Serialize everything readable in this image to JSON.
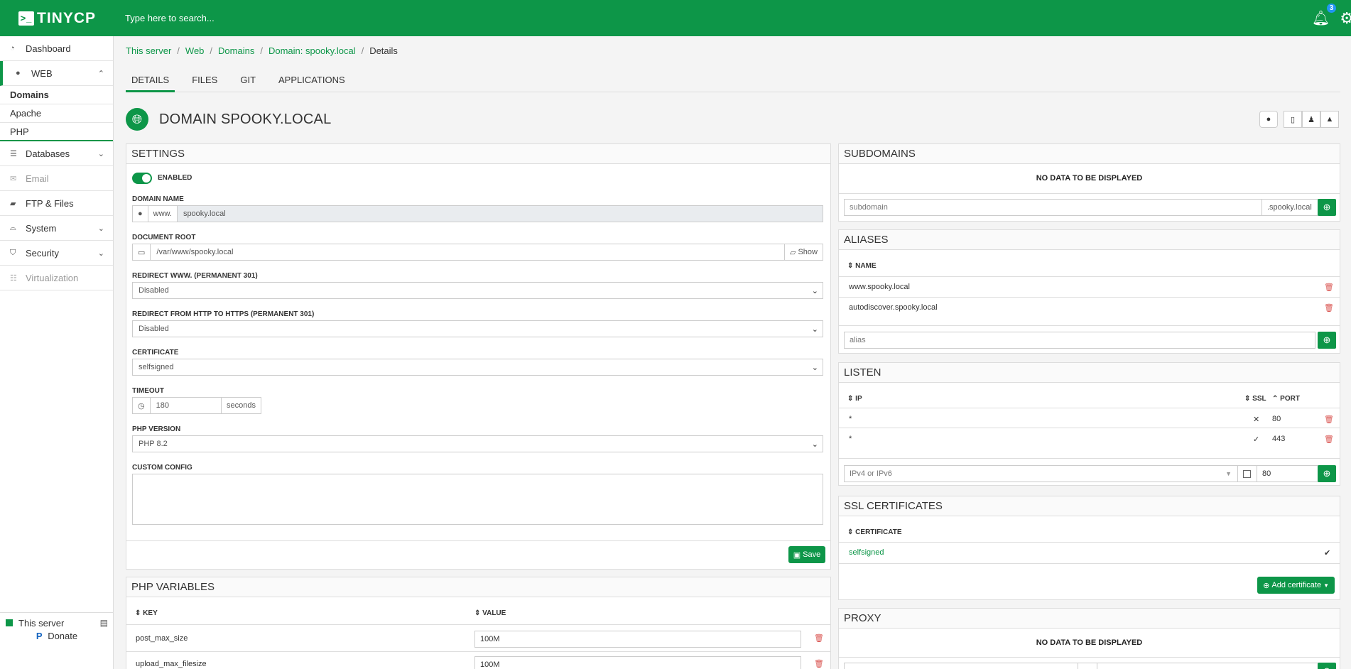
{
  "app": {
    "logo": "TINYCP",
    "search_placeholder": "Type here to search...",
    "notification_count": "3"
  },
  "sidebar": {
    "items": [
      {
        "label": "Dashboard"
      },
      {
        "label": "WEB"
      },
      {
        "label": "Databases"
      },
      {
        "label": "Email"
      },
      {
        "label": "FTP & Files"
      },
      {
        "label": "System"
      },
      {
        "label": "Security"
      },
      {
        "label": "Virtualization"
      }
    ],
    "web_sub": [
      {
        "label": "Domains"
      },
      {
        "label": "Apache"
      },
      {
        "label": "PHP"
      }
    ],
    "donate": "Donate",
    "server": "This server"
  },
  "breadcrumb": [
    "This server",
    "Web",
    "Domains",
    "Domain: spooky.local",
    "Details"
  ],
  "tabs": [
    "DETAILS",
    "FILES",
    "GIT",
    "APPLICATIONS"
  ],
  "page": {
    "title": "DOMAIN SPOOKY.LOCAL"
  },
  "settings": {
    "title": "SETTINGS",
    "enabled_label": "ENABLED",
    "domain_name_label": "DOMAIN NAME",
    "www_prefix": "www.",
    "domain_name": "spooky.local",
    "docroot_label": "DOCUMENT ROOT",
    "docroot": "/var/www/spooky.local",
    "show_label": "Show",
    "redirect_www_label": "REDIRECT WWW. (PERMANENT 301)",
    "redirect_www": "Disabled",
    "redirect_https_label": "REDIRECT FROM HTTP TO HTTPS (PERMANENT 301)",
    "redirect_https": "Disabled",
    "certificate_label": "CERTIFICATE",
    "certificate": "selfsigned",
    "timeout_label": "TIMEOUT",
    "timeout": "180",
    "timeout_unit": "seconds",
    "php_label": "PHP VERSION",
    "php": "PHP 8.2",
    "custom_config_label": "CUSTOM CONFIG",
    "save": "Save"
  },
  "php_vars": {
    "title": "PHP VARIABLES",
    "col_key": "KEY",
    "col_value": "VALUE",
    "rows": [
      {
        "key": "post_max_size",
        "value": "100M"
      },
      {
        "key": "upload_max_filesize",
        "value": "100M"
      }
    ]
  },
  "subdomains": {
    "title": "SUBDOMAINS",
    "empty": "NO DATA TO BE DISPLAYED",
    "placeholder": "subdomain",
    "suffix": ".spooky.local"
  },
  "aliases": {
    "title": "ALIASES",
    "col_name": "NAME",
    "rows": [
      "www.spooky.local",
      "autodiscover.spooky.local"
    ],
    "placeholder": "alias"
  },
  "listen": {
    "title": "LISTEN",
    "col_ip": "IP",
    "col_ssl": "SSL",
    "col_port": "PORT",
    "rows": [
      {
        "ip": "*",
        "ssl": "✕",
        "port": "80"
      },
      {
        "ip": "*",
        "ssl": "✓",
        "port": "443"
      }
    ],
    "ip_placeholder": "IPv4 or IPv6",
    "port_value": "80"
  },
  "ssl": {
    "title": "SSL CERTIFICATES",
    "col_cert": "CERTIFICATE",
    "rows": [
      "selfsigned"
    ],
    "add": "Add certificate"
  },
  "proxy": {
    "title": "PROXY",
    "empty": "NO DATA TO BE DISPLAYED"
  }
}
